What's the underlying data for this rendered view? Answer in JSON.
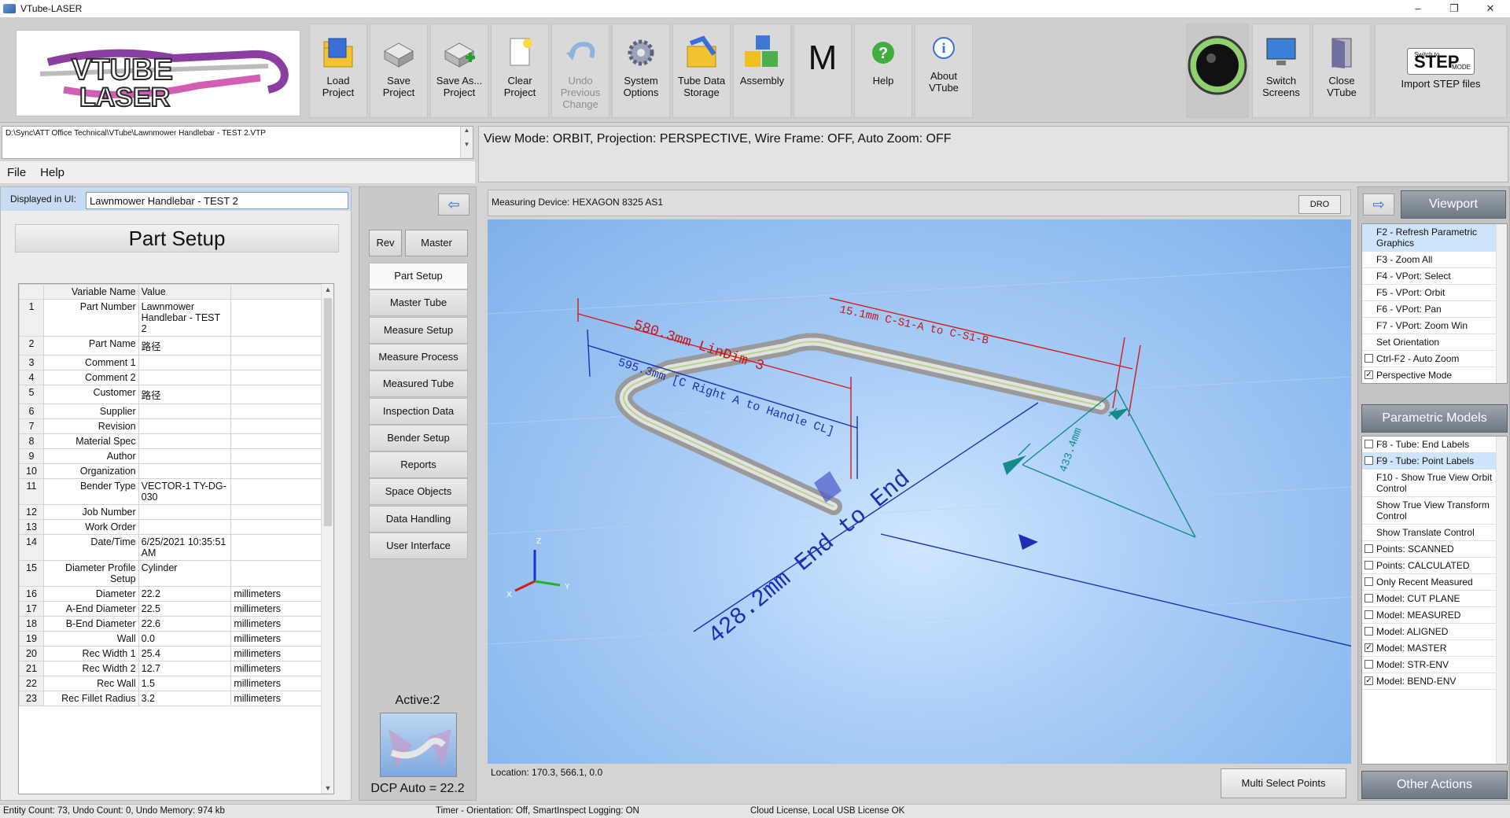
{
  "window": {
    "title": "VTube-LASER",
    "min": "–",
    "restore": "❐",
    "close": "✕"
  },
  "toolbar": {
    "logo_text": "VTUBE LASER",
    "buttons": [
      {
        "label": "Load Project",
        "icon": "folder-icon"
      },
      {
        "label": "Save Project",
        "icon": "drive-icon"
      },
      {
        "label": "Save As... Project",
        "icon": "drive-add-icon"
      },
      {
        "label": "Clear Project",
        "icon": "new-page-icon"
      },
      {
        "label": "Undo Previous Change",
        "icon": "undo-icon"
      },
      {
        "label": "System Options",
        "icon": "gear-icon"
      },
      {
        "label": "Tube Data Storage",
        "icon": "folder-tube-icon"
      },
      {
        "label": "Assembly",
        "icon": "cubes-icon"
      },
      {
        "label": "M",
        "icon": "m-letter"
      },
      {
        "label": "Help",
        "icon": "help-icon"
      },
      {
        "label": "About VTube",
        "icon": "info-icon"
      }
    ],
    "switch_screens": "Switch Screens",
    "close_vtube": "Close VTube",
    "step_small": "Switch to",
    "step_big": "STEP",
    "step_mode": "MODE",
    "import_step": "Import STEP files"
  },
  "project_path": "D:\\Sync\\ATT Office Technical\\VTube\\Lawnmower Handlebar - TEST 2.VTP",
  "view_mode": "View Mode: ORBIT, Projection: PERSPECTIVE, Wire Frame: OFF, Auto Zoom: OFF",
  "menu": {
    "file": "File",
    "help": "Help"
  },
  "left": {
    "displayed_label": "Displayed in UI:",
    "displayed_value": "Lawnmower Handlebar - TEST 2",
    "section_title": "Part Setup",
    "col_name": "Variable Name",
    "col_value": "Value",
    "rows": [
      {
        "n": "1",
        "k": "Part Number",
        "v": "Lawnmower Handlebar - TEST 2",
        "u": ""
      },
      {
        "n": "2",
        "k": "Part Name",
        "v": "路径",
        "u": ""
      },
      {
        "n": "3",
        "k": "Comment 1",
        "v": "",
        "u": ""
      },
      {
        "n": "4",
        "k": "Comment 2",
        "v": "",
        "u": ""
      },
      {
        "n": "5",
        "k": "Customer",
        "v": "路径",
        "u": ""
      },
      {
        "n": "6",
        "k": "Supplier",
        "v": "",
        "u": ""
      },
      {
        "n": "7",
        "k": "Revision",
        "v": "",
        "u": ""
      },
      {
        "n": "8",
        "k": "Material Spec",
        "v": "",
        "u": ""
      },
      {
        "n": "9",
        "k": "Author",
        "v": "",
        "u": ""
      },
      {
        "n": "10",
        "k": "Organization",
        "v": "",
        "u": ""
      },
      {
        "n": "11",
        "k": "Bender Type",
        "v": "VECTOR-1 TY-DG-030",
        "u": ""
      },
      {
        "n": "12",
        "k": "Job Number",
        "v": "",
        "u": ""
      },
      {
        "n": "13",
        "k": "Work Order",
        "v": "",
        "u": ""
      },
      {
        "n": "14",
        "k": "Date/Time",
        "v": "6/25/2021 10:35:51 AM",
        "u": ""
      },
      {
        "n": "15",
        "k": "Diameter Profile Setup",
        "v": "Cylinder",
        "u": ""
      },
      {
        "n": "16",
        "k": "Diameter",
        "v": "22.2",
        "u": "millimeters"
      },
      {
        "n": "17",
        "k": "A-End Diameter",
        "v": "22.5",
        "u": "millimeters"
      },
      {
        "n": "18",
        "k": "B-End Diameter",
        "v": "22.6",
        "u": "millimeters"
      },
      {
        "n": "19",
        "k": "Wall",
        "v": "0.0",
        "u": "millimeters"
      },
      {
        "n": "20",
        "k": "Rec Width 1",
        "v": "25.4",
        "u": "millimeters"
      },
      {
        "n": "21",
        "k": "Rec Width 2",
        "v": "12.7",
        "u": "millimeters"
      },
      {
        "n": "22",
        "k": "Rec Wall",
        "v": "1.5",
        "u": "millimeters"
      },
      {
        "n": "23",
        "k": "Rec Fillet Radius",
        "v": "3.2",
        "u": "millimeters"
      }
    ]
  },
  "nav": {
    "back_arrow": "⇦",
    "rev": "Rev",
    "master": "Master",
    "items": [
      "Part Setup",
      "Master Tube",
      "Measure Setup",
      "Measure Process",
      "Measured Tube",
      "Inspection Data",
      "Bender Setup",
      "Reports",
      "Space Objects",
      "Data Handling",
      "User Interface"
    ],
    "active": "Active:2",
    "dcp": "DCP Auto = 22.2"
  },
  "viewport": {
    "device": "Measuring Device: HEXAGON 8325 AS1",
    "dro": "DRO",
    "dim1": "580.3mm LinDim 3",
    "dim2": "595.3mm [C Right A to Handle CL]",
    "dim3": "15.1mm C-S1-A to C-S1-B",
    "dim4": "433.4mm",
    "dim5": "428.2mm End to End",
    "axis_x": "X",
    "axis_y": "Y",
    "axis_z": "Z",
    "location": "Location: 170.3, 566.1, 0.0",
    "multi_select": "Multi Select Points"
  },
  "right": {
    "arrow": "⇨",
    "viewport_hdr": "Viewport",
    "viewport_items": [
      {
        "label": "F2 - Refresh Parametric Graphics",
        "cb": false,
        "check": "",
        "sel": true
      },
      {
        "label": "F3 - Zoom All",
        "cb": false,
        "check": "",
        "sel": false
      },
      {
        "label": "F4 - VPort: Select",
        "cb": false,
        "check": "",
        "sel": false
      },
      {
        "label": "F5 - VPort: Orbit",
        "cb": false,
        "check": "",
        "sel": false
      },
      {
        "label": "F6 - VPort: Pan",
        "cb": false,
        "check": "",
        "sel": false
      },
      {
        "label": "F7 - VPort: Zoom Win",
        "cb": false,
        "check": "",
        "sel": false
      },
      {
        "label": "Set Orientation",
        "cb": false,
        "check": "",
        "sel": false
      },
      {
        "label": "Ctrl-F2 - Auto Zoom",
        "cb": true,
        "check": "",
        "sel": false
      },
      {
        "label": "Perspective Mode",
        "cb": true,
        "check": "✓",
        "sel": false
      }
    ],
    "param_hdr": "Parametric Models",
    "param_items": [
      {
        "label": "F8 - Tube: End Labels",
        "cb": true,
        "check": "",
        "sel": false
      },
      {
        "label": "F9 - Tube: Point Labels",
        "cb": true,
        "check": "",
        "sel": true
      },
      {
        "label": "F10 - Show True View Orbit Control",
        "cb": false,
        "check": "",
        "sel": false
      },
      {
        "label": "Show True View Transform Control",
        "cb": false,
        "check": "",
        "sel": false
      },
      {
        "label": "Show Translate Control",
        "cb": false,
        "check": "",
        "sel": false
      },
      {
        "label": "Points: SCANNED",
        "cb": true,
        "check": "",
        "sel": false
      },
      {
        "label": "Points: CALCULATED",
        "cb": true,
        "check": "",
        "sel": false
      },
      {
        "label": "Only Recent Measured",
        "cb": true,
        "check": "",
        "sel": false
      },
      {
        "label": "Model: CUT PLANE",
        "cb": true,
        "check": "",
        "sel": false
      },
      {
        "label": "Model: MEASURED",
        "cb": true,
        "check": "",
        "sel": false
      },
      {
        "label": "Model: ALIGNED",
        "cb": true,
        "check": "",
        "sel": false
      },
      {
        "label": "Model: MASTER",
        "cb": true,
        "check": "✓",
        "sel": false
      },
      {
        "label": "Model: STR-ENV",
        "cb": true,
        "check": "",
        "sel": false
      },
      {
        "label": "Model: BEND-ENV",
        "cb": true,
        "check": "✓",
        "sel": false
      }
    ],
    "other_hdr": "Other Actions"
  },
  "status": {
    "entity": "Entity Count: 73, Undo Count: 0, Undo Memory: 974 kb",
    "timer": "Timer - Orientation: Off, SmartInspect Logging: ON",
    "license": "Cloud License, Local USB License OK"
  }
}
